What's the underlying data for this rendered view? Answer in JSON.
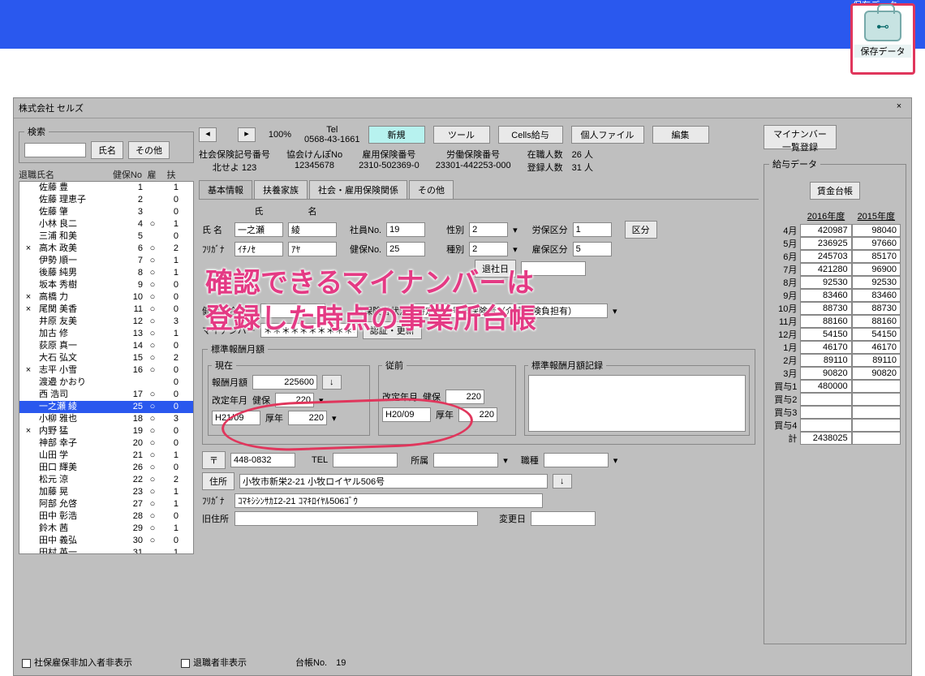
{
  "topbar": {
    "label": "保存データ",
    "btn": "保存データ"
  },
  "window": {
    "title": "株式会社 セルズ",
    "close": "×"
  },
  "search": {
    "legend": "検索",
    "name_btn": "氏名",
    "other_btn": "その他"
  },
  "list_header": {
    "c1": "退職",
    "c2": "氏名",
    "c3": "健保No",
    "c4": "雇",
    "c5": "扶"
  },
  "employees": [
    {
      "r": "",
      "n": "佐藤 豊",
      "no": "1",
      "e": "",
      "f": "1"
    },
    {
      "r": "",
      "n": "佐藤 理恵子",
      "no": "2",
      "e": "",
      "f": "0"
    },
    {
      "r": "",
      "n": "佐藤 肇",
      "no": "3",
      "e": "",
      "f": "0"
    },
    {
      "r": "",
      "n": "小林 良二",
      "no": "4",
      "e": "○",
      "f": "1"
    },
    {
      "r": "",
      "n": "三浦 和美",
      "no": "5",
      "e": "",
      "f": "0"
    },
    {
      "r": "×",
      "n": "高木 政美",
      "no": "6",
      "e": "○",
      "f": "2"
    },
    {
      "r": "",
      "n": "伊勢 順一",
      "no": "7",
      "e": "○",
      "f": "1"
    },
    {
      "r": "",
      "n": "後藤 純男",
      "no": "8",
      "e": "○",
      "f": "1"
    },
    {
      "r": "",
      "n": "坂本 秀樹",
      "no": "9",
      "e": "○",
      "f": "0"
    },
    {
      "r": "×",
      "n": "高橋 力",
      "no": "10",
      "e": "○",
      "f": "0"
    },
    {
      "r": "×",
      "n": "尾関 美香",
      "no": "11",
      "e": "○",
      "f": "0"
    },
    {
      "r": "",
      "n": "井原 友美",
      "no": "12",
      "e": "○",
      "f": "3"
    },
    {
      "r": "",
      "n": "加古 修",
      "no": "13",
      "e": "○",
      "f": "1"
    },
    {
      "r": "",
      "n": "荻原 真一",
      "no": "14",
      "e": "○",
      "f": "0"
    },
    {
      "r": "",
      "n": "大石 弘文",
      "no": "15",
      "e": "○",
      "f": "2"
    },
    {
      "r": "×",
      "n": "志平 小雪",
      "no": "16",
      "e": "○",
      "f": "0"
    },
    {
      "r": "",
      "n": "渡邉 かおり",
      "no": "",
      "e": "",
      "f": "0"
    },
    {
      "r": "",
      "n": "西 浩司",
      "no": "17",
      "e": "○",
      "f": "0"
    },
    {
      "r": "",
      "n": "一之瀬 綾",
      "no": "25",
      "e": "○",
      "f": "0",
      "sel": true
    },
    {
      "r": "",
      "n": "小柳 雅也",
      "no": "18",
      "e": "○",
      "f": "3"
    },
    {
      "r": "×",
      "n": "内野 猛",
      "no": "19",
      "e": "○",
      "f": "0"
    },
    {
      "r": "",
      "n": "神部 幸子",
      "no": "20",
      "e": "○",
      "f": "0"
    },
    {
      "r": "",
      "n": "山田 学",
      "no": "21",
      "e": "○",
      "f": "1"
    },
    {
      "r": "",
      "n": "田口 輝美",
      "no": "26",
      "e": "○",
      "f": "0"
    },
    {
      "r": "",
      "n": "松元 涼",
      "no": "22",
      "e": "○",
      "f": "2"
    },
    {
      "r": "",
      "n": "加藤 晃",
      "no": "23",
      "e": "○",
      "f": "1"
    },
    {
      "r": "",
      "n": "阿部 允啓",
      "no": "27",
      "e": "○",
      "f": "1"
    },
    {
      "r": "",
      "n": "田中 彰浩",
      "no": "28",
      "e": "○",
      "f": "0"
    },
    {
      "r": "",
      "n": "鈴木 茜",
      "no": "29",
      "e": "○",
      "f": "1"
    },
    {
      "r": "",
      "n": "田中 義弘",
      "no": "30",
      "e": "○",
      "f": "0"
    },
    {
      "r": "",
      "n": "田村 英一",
      "no": "31",
      "e": "",
      "f": "1"
    }
  ],
  "toolbar": {
    "zoom": "100%",
    "tel_lbl": "Tel",
    "tel": "0568-43-1661",
    "new": "新規",
    "tool": "ツール",
    "cells": "Cells給与",
    "pfile": "個人ファイル",
    "edit": "編集",
    "myno": "マイナンバー\n一覧登録"
  },
  "org": {
    "addr_lbl": "社会保険記号番号",
    "addr": "北せよ 123",
    "kno_lbl": "協会けんぽNo",
    "kno": "12345678",
    "emp_lbl": "雇用保険番号",
    "emp": "2310-502369-0",
    "lab_lbl": "労働保険番号",
    "lab": "23301-442253-000",
    "cnt1_lbl": "在職人数",
    "cnt1": "26",
    "cnt2_lbl": "登録人数",
    "cnt2": "31",
    "unit": "人"
  },
  "tabs": {
    "t1": "基本情報",
    "t2": "扶養家族",
    "t3": "社会・雇用保険関係",
    "t4": "その他"
  },
  "form": {
    "shi_lbl": "氏",
    "mei_lbl": "名",
    "name_lbl": "氏 名",
    "furi_lbl": "ﾌﾘｶﾞﾅ",
    "last": "一之瀬",
    "first": "綾",
    "last_k": "ｲﾁﾉｾ",
    "first_k": "ｱﾔ",
    "sno_lbl": "社員No.",
    "sno": "19",
    "kno_lbl": "健保No.",
    "kno": "25",
    "sex_lbl": "性別",
    "sex": "2",
    "kind_lbl": "種別",
    "kind": "2",
    "lkbn_lbl": "労保区分",
    "lkbn": "1",
    "ekbn_lbl": "雇保区分",
    "ekbn": "5",
    "kbn_btn": "区分",
    "ret_lbl": "退社日",
    "hbango_lbl": "健保組合番号",
    "status_lbl": "被保険者状況",
    "status": "特定第二号被保険者（介護保険負担有）",
    "myno_lbl": "マイナンバー",
    "myno": "＊＊＊＊＊＊＊＊＊＊＊＊",
    "auth_btn": "認証・更新",
    "hbox_lbl": "標準報酬月額",
    "now_lbl": "現在",
    "prev_lbl": "従前",
    "rec_lbl": "標準報酬月額記録",
    "hget_lbl": "報酬月額",
    "hget": "225600",
    "kym_lbl": "改定年月",
    "kym1": "H21/09",
    "kp_lbl": "健保",
    "kp": "220",
    "ky_lbl": "厚年",
    "ky": "220",
    "kym2": "H20/09",
    "kp2_lbl": "健保",
    "kp2": "220",
    "ky2_lbl": "厚年",
    "ky2": "220",
    "zip": "448-0832",
    "zip_btn": "〒",
    "tel_lbl": "TEL",
    "dept_lbl": "所属",
    "job_lbl": "職種",
    "addr_btn": "住所",
    "addr": "小牧市新栄2-21 小牧ロイヤル506号",
    "furk_lbl": "ﾌﾘｶﾞﾅ",
    "addr_k": "ｺﾏｷｼｼﾝｻｶｴ2-21 ｺﾏｷﾛｲﾔﾙ506ｺﾞｳ",
    "oldaddr_lbl": "旧住所",
    "chgd_lbl": "変更日"
  },
  "annot": {
    "line1": "確認できるマイナンバーは",
    "line2": "登録した時点の事業所台帳"
  },
  "pay": {
    "legend": "給与データ",
    "book_btn": "賃金台帳",
    "y1": "2016年度",
    "y2": "2015年度",
    "months": [
      "4月",
      "5月",
      "6月",
      "7月",
      "8月",
      "9月",
      "10月",
      "11月",
      "12月",
      "1月",
      "2月",
      "3月"
    ],
    "col1": [
      "420987",
      "236925",
      "245703",
      "421280",
      "92530",
      "83460",
      "88730",
      "88160",
      "54150",
      "46170",
      "89110",
      "90820"
    ],
    "col2": [
      "98040",
      "97660",
      "85170",
      "96900",
      "92530",
      "83460",
      "88730",
      "88160",
      "54150",
      "46170",
      "89110",
      "90820"
    ],
    "bonus_lbl": [
      "買与1",
      "買与2",
      "買与3",
      "買与4"
    ],
    "bonus1": [
      "480000",
      "",
      "",
      ""
    ],
    "bonus2": [
      "",
      "",
      "",
      ""
    ],
    "total_lbl": "計",
    "total": "2438025"
  },
  "bottom": {
    "chk1": "社保雇保非加入者非表示",
    "chk2": "退職者非表示",
    "bno_lbl": "台帳No.",
    "bno": "19"
  }
}
